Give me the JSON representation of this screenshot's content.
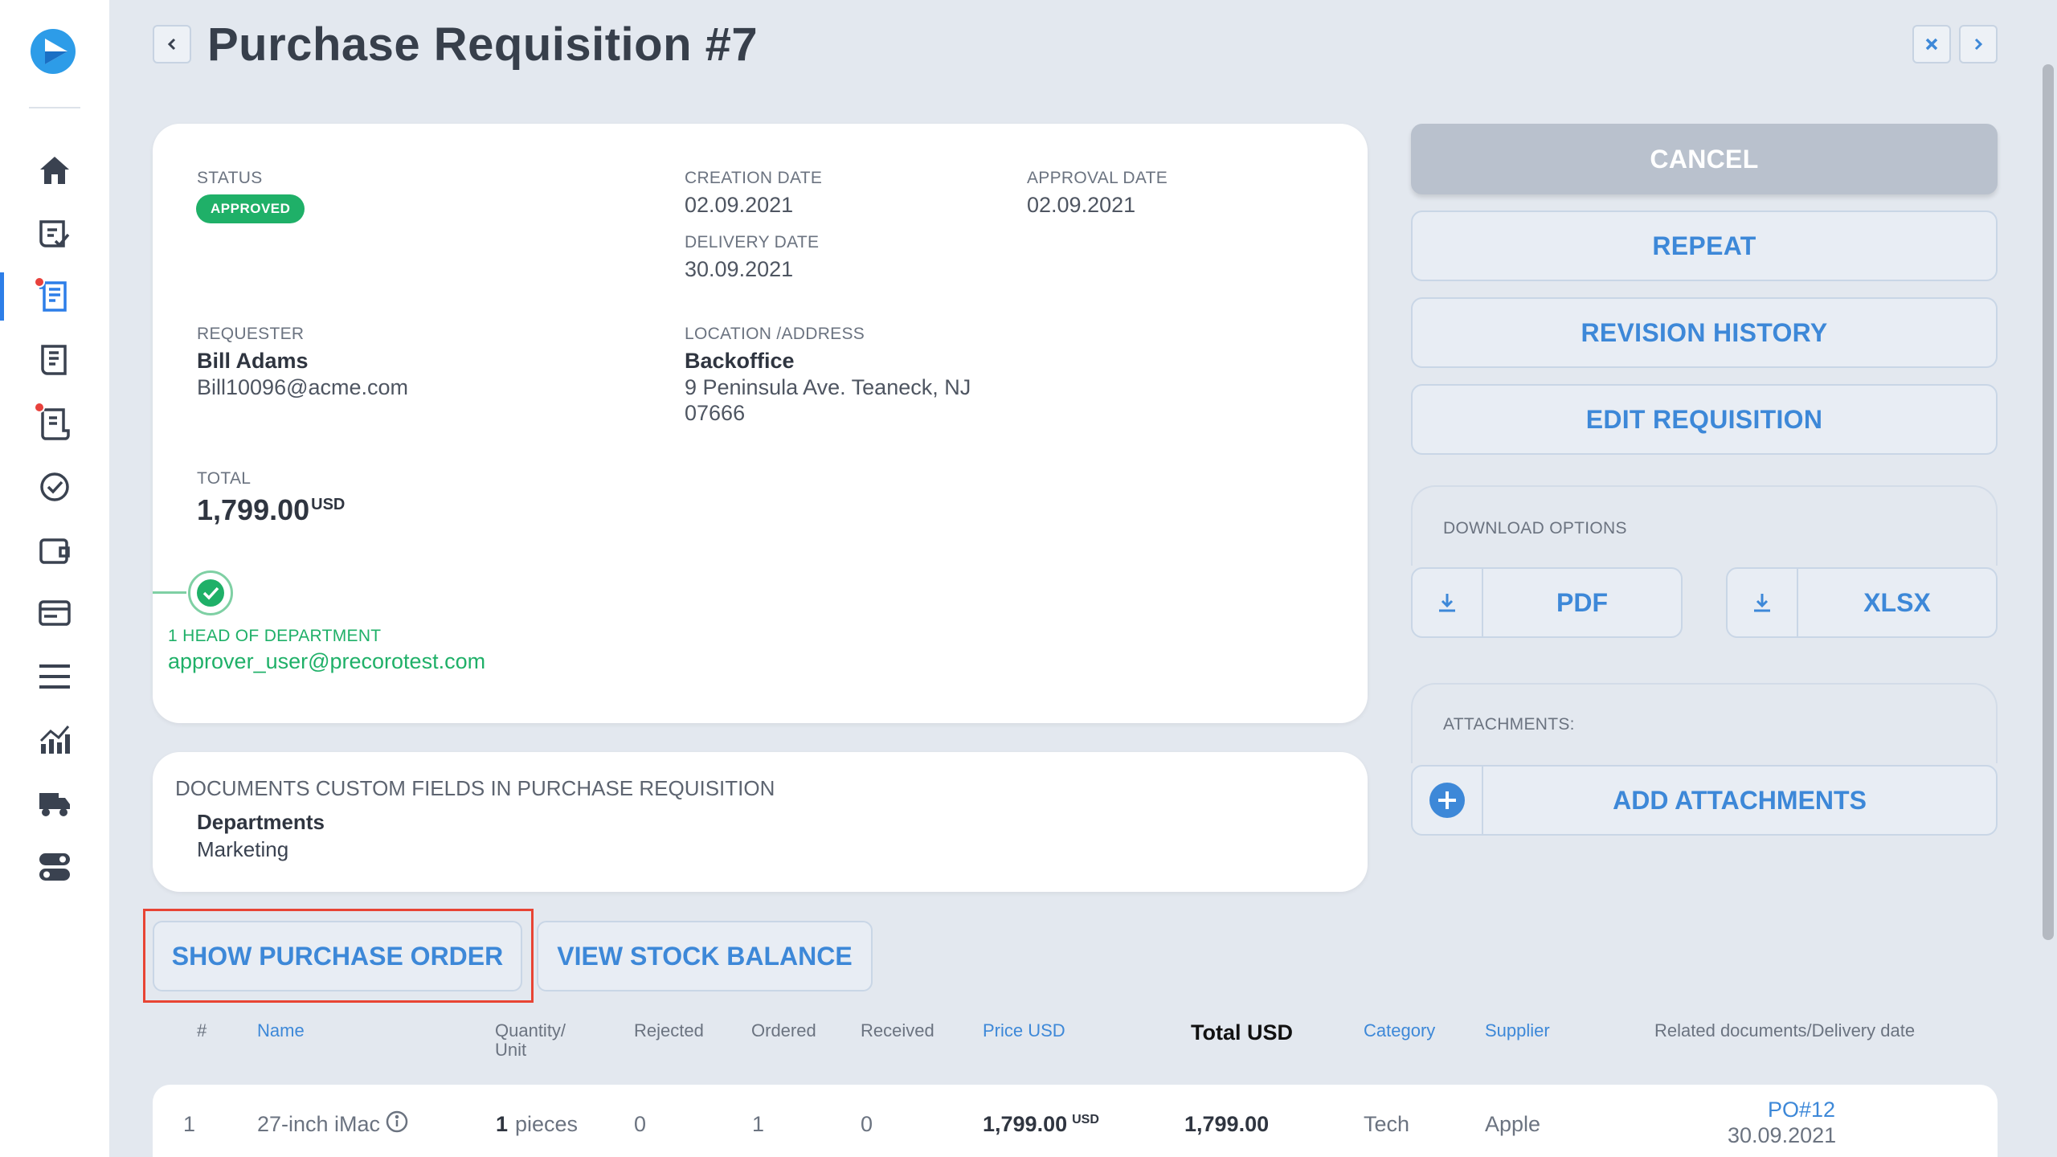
{
  "header": {
    "title": "Purchase Requisition #7"
  },
  "details": {
    "status_label": "STATUS",
    "status_value": "APPROVED",
    "creation_label": "CREATION DATE",
    "creation_value": "02.09.2021",
    "delivery_label": "DELIVERY DATE",
    "delivery_value": "30.09.2021",
    "approval_label": "APPROVAL DATE",
    "approval_value": "02.09.2021",
    "requester_label": "REQUESTER",
    "requester_name": "Bill Adams",
    "requester_email": "Bill10096@acme.com",
    "location_label": "LOCATION /ADDRESS",
    "location_name": "Backoffice",
    "location_line1": "9 Peninsula Ave. Teaneck, NJ",
    "location_line2": "07666",
    "total_label": "TOTAL",
    "total_value": "1,799.00",
    "total_currency": "USD",
    "approver_role": "1 HEAD OF DEPARTMENT",
    "approver_email": "approver_user@precorotest.com"
  },
  "custom_fields": {
    "title": "DOCUMENTS CUSTOM FIELDS IN PURCHASE REQUISITION",
    "field_label": "Departments",
    "field_value": "Marketing"
  },
  "actions": {
    "cancel": "CANCEL",
    "repeat": "REPEAT",
    "revision_history": "REVISION HISTORY",
    "edit_requisition": "EDIT REQUISITION",
    "download_label": "DOWNLOAD OPTIONS",
    "pdf": "PDF",
    "xlsx": "XLSX",
    "attachments_label": "ATTACHMENTS:",
    "add_attachments": "ADD ATTACHMENTS",
    "show_purchase_order": "SHOW PURCHASE ORDER",
    "view_stock_balance": "VIEW STOCK BALANCE"
  },
  "table": {
    "headers": {
      "num": "#",
      "name": "Name",
      "quantity": "Quantity/",
      "unit": "Unit",
      "rejected": "Rejected",
      "ordered": "Ordered",
      "received": "Received",
      "price": "Price USD",
      "total": "Total USD",
      "category": "Category",
      "supplier": "Supplier",
      "related": "Related documents/Delivery date"
    },
    "rows": [
      {
        "num": "1",
        "name": "27-inch iMac",
        "qty": "1",
        "unit": "pieces",
        "rejected": "0",
        "ordered": "1",
        "received": "0",
        "price": "1,799.00",
        "price_currency": "USD",
        "total": "1,799.00",
        "category": "Tech",
        "supplier": "Apple",
        "related_doc": "PO#12",
        "delivery_date": "30.09.2021"
      }
    ]
  },
  "colors": {
    "accent": "#3d88d8",
    "approved": "#1fb068",
    "highlight": "#e84434"
  }
}
